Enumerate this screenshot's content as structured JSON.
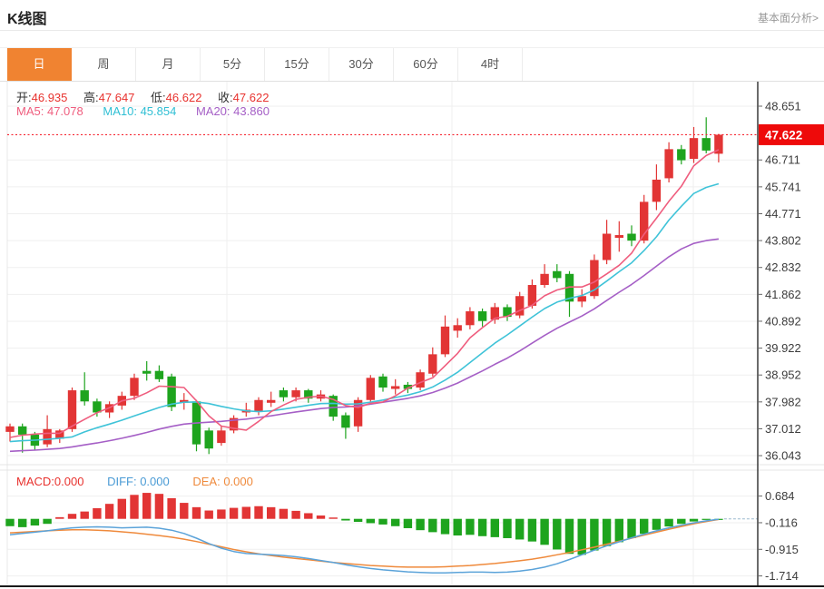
{
  "header": {
    "title": "K线图",
    "link": "基本面分析>"
  },
  "tabs": [
    {
      "label": "日",
      "active": true
    },
    {
      "label": "周"
    },
    {
      "label": "月"
    },
    {
      "label": "5分"
    },
    {
      "label": "15分"
    },
    {
      "label": "30分"
    },
    {
      "label": "60分"
    },
    {
      "label": "4时"
    }
  ],
  "ohlc": {
    "open_label": "开:",
    "open": "46.935",
    "high_label": "高:",
    "high": "47.647",
    "low_label": "低:",
    "low": "46.622",
    "close_label": "收:",
    "close": "47.622"
  },
  "ma_legend": {
    "ma5_label": "MA5:",
    "ma5": "47.078",
    "ma10_label": "MA10:",
    "ma10": "45.854",
    "ma20_label": "MA20:",
    "ma20": "43.860"
  },
  "macd_legend": {
    "macd_label": "MACD:",
    "macd": "0.000",
    "diff_label": "DIFF:",
    "diff": "0.000",
    "dea_label": "DEA:",
    "dea": "0.000"
  },
  "price_tag": {
    "value": "47.622"
  },
  "colors": {
    "up": "#e23535",
    "down": "#1ea41e",
    "ma5": "#ef5d7e",
    "ma10": "#3fc3d8",
    "ma20": "#a55fc6",
    "diff_line": "#5ba3d9",
    "dea_line": "#ef8a3c",
    "price_line": "#f5222d",
    "price_tag_bg": "#ee0a0a",
    "accent_tab": "#f08331",
    "axis": "#3a3a3a",
    "grid": "#efefef"
  },
  "chart_data": {
    "type": "candlestick+macd",
    "main": {
      "title": "K线图 (daily)",
      "price_line": 47.622,
      "y_ticks": [
        48.651,
        46.711,
        45.741,
        44.771,
        43.802,
        42.832,
        41.862,
        40.892,
        39.922,
        38.952,
        37.982,
        37.012,
        36.043
      ],
      "candles": [
        [
          36.9,
          37.2,
          36.55,
          37.1
        ],
        [
          37.1,
          37.2,
          36.15,
          36.8
        ],
        [
          36.8,
          36.9,
          36.25,
          36.4
        ],
        [
          36.45,
          37.5,
          36.35,
          37.0
        ],
        [
          36.65,
          37.0,
          36.5,
          36.95
        ],
        [
          37.0,
          38.5,
          36.9,
          38.4
        ],
        [
          38.4,
          39.05,
          37.85,
          38.0
        ],
        [
          38.0,
          38.1,
          37.45,
          37.6
        ],
        [
          37.6,
          38.0,
          37.4,
          37.9
        ],
        [
          37.85,
          38.35,
          37.7,
          38.2
        ],
        [
          38.2,
          39.0,
          38.05,
          38.85
        ],
        [
          39.1,
          39.45,
          38.75,
          39.0
        ],
        [
          39.1,
          39.3,
          38.7,
          38.8
        ],
        [
          38.9,
          39.0,
          37.65,
          37.8
        ],
        [
          37.95,
          38.3,
          37.7,
          38.05
        ],
        [
          38.0,
          38.05,
          36.2,
          36.45
        ],
        [
          36.95,
          37.05,
          36.1,
          36.3
        ],
        [
          36.5,
          37.1,
          36.4,
          36.95
        ],
        [
          36.95,
          37.5,
          36.85,
          37.4
        ],
        [
          37.6,
          37.95,
          37.45,
          37.7
        ],
        [
          37.65,
          38.15,
          37.5,
          38.05
        ],
        [
          37.95,
          38.35,
          37.8,
          38.05
        ],
        [
          38.4,
          38.5,
          38.0,
          38.15
        ],
        [
          38.15,
          38.5,
          38.0,
          38.4
        ],
        [
          38.4,
          38.45,
          37.95,
          38.1
        ],
        [
          38.1,
          38.4,
          38.0,
          38.25
        ],
        [
          38.2,
          38.25,
          37.3,
          37.45
        ],
        [
          37.5,
          37.6,
          36.65,
          37.05
        ],
        [
          37.1,
          38.15,
          36.9,
          38.05
        ],
        [
          38.05,
          38.95,
          37.9,
          38.85
        ],
        [
          38.9,
          39.0,
          38.35,
          38.5
        ],
        [
          38.45,
          38.8,
          38.25,
          38.55
        ],
        [
          38.6,
          38.7,
          38.3,
          38.45
        ],
        [
          38.5,
          39.15,
          38.4,
          39.05
        ],
        [
          39.0,
          39.95,
          38.9,
          39.7
        ],
        [
          39.7,
          41.1,
          39.6,
          40.7
        ],
        [
          40.55,
          41.0,
          40.3,
          40.75
        ],
        [
          40.75,
          41.4,
          40.6,
          41.25
        ],
        [
          41.25,
          41.35,
          40.7,
          40.9
        ],
        [
          40.95,
          41.55,
          40.8,
          41.4
        ],
        [
          41.4,
          41.5,
          40.9,
          41.05
        ],
        [
          41.1,
          41.95,
          41.0,
          41.8
        ],
        [
          41.45,
          42.4,
          41.35,
          42.2
        ],
        [
          42.2,
          42.95,
          42.1,
          42.6
        ],
        [
          42.7,
          42.95,
          42.3,
          42.45
        ],
        [
          42.6,
          42.7,
          41.05,
          41.6
        ],
        [
          41.6,
          42.05,
          41.4,
          41.8
        ],
        [
          41.8,
          43.3,
          41.7,
          43.1
        ],
        [
          43.1,
          44.55,
          42.95,
          44.05
        ],
        [
          43.9,
          44.5,
          43.4,
          44.0
        ],
        [
          44.05,
          44.35,
          43.6,
          43.8
        ],
        [
          43.8,
          45.45,
          43.7,
          45.2
        ],
        [
          45.2,
          46.55,
          44.9,
          46.0
        ],
        [
          46.05,
          47.35,
          45.9,
          47.1
        ],
        [
          47.1,
          47.25,
          46.55,
          46.7
        ],
        [
          46.75,
          47.9,
          46.6,
          47.5
        ],
        [
          47.5,
          48.25,
          46.95,
          47.05
        ],
        [
          46.935,
          47.647,
          46.622,
          47.622
        ]
      ],
      "ma5": [
        36.7,
        36.78,
        36.82,
        36.85,
        36.85,
        37.11,
        37.35,
        37.59,
        37.77,
        38.02,
        38.11,
        38.31,
        38.55,
        38.53,
        38.5,
        38.02,
        37.48,
        37.11,
        37.03,
        36.96,
        37.28,
        37.63,
        37.87,
        38.07,
        38.15,
        38.19,
        38.07,
        37.85,
        37.78,
        37.93,
        37.98,
        38.2,
        38.48,
        38.68,
        38.85,
        39.29,
        39.73,
        40.29,
        40.66,
        41.0,
        41.07,
        41.28,
        41.47,
        41.81,
        42.02,
        42.13,
        42.13,
        42.31,
        42.6,
        42.91,
        43.35,
        44.03,
        44.61,
        45.22,
        45.76,
        46.5,
        46.87,
        47.08
      ],
      "ma10": [
        36.55,
        36.58,
        36.6,
        36.63,
        36.67,
        36.72,
        36.9,
        37.05,
        37.18,
        37.32,
        37.48,
        37.63,
        37.78,
        37.9,
        37.97,
        37.98,
        37.92,
        37.82,
        37.73,
        37.66,
        37.63,
        37.66,
        37.72,
        37.79,
        37.86,
        37.92,
        37.93,
        37.9,
        37.91,
        37.97,
        38.05,
        38.14,
        38.23,
        38.35,
        38.52,
        38.77,
        39.05,
        39.4,
        39.75,
        40.1,
        40.4,
        40.72,
        41.04,
        41.35,
        41.58,
        41.72,
        41.82,
        42.02,
        42.34,
        42.68,
        43.0,
        43.44,
        43.94,
        44.54,
        45.04,
        45.5,
        45.72,
        45.85
      ],
      "ma20": [
        36.2,
        36.22,
        36.24,
        36.27,
        36.3,
        36.36,
        36.43,
        36.5,
        36.58,
        36.67,
        36.77,
        36.88,
        37.0,
        37.1,
        37.18,
        37.22,
        37.25,
        37.28,
        37.32,
        37.36,
        37.42,
        37.48,
        37.55,
        37.62,
        37.68,
        37.74,
        37.78,
        37.8,
        37.84,
        37.9,
        37.97,
        38.04,
        38.11,
        38.2,
        38.32,
        38.48,
        38.66,
        38.88,
        39.1,
        39.34,
        39.56,
        39.82,
        40.1,
        40.38,
        40.64,
        40.86,
        41.08,
        41.34,
        41.64,
        41.94,
        42.22,
        42.54,
        42.88,
        43.22,
        43.5,
        43.7,
        43.8,
        43.86
      ]
    },
    "macd": {
      "y_ticks": [
        0.684,
        -0.116,
        -0.915,
        -1.714
      ],
      "hist": [
        -0.22,
        -0.25,
        -0.2,
        -0.15,
        0.05,
        0.15,
        0.22,
        0.32,
        0.45,
        0.6,
        0.72,
        0.78,
        0.75,
        0.62,
        0.48,
        0.35,
        0.25,
        0.28,
        0.33,
        0.36,
        0.38,
        0.35,
        0.3,
        0.24,
        0.17,
        0.1,
        0.04,
        -0.05,
        -0.09,
        -0.13,
        -0.17,
        -0.22,
        -0.28,
        -0.34,
        -0.4,
        -0.46,
        -0.5,
        -0.48,
        -0.52,
        -0.55,
        -0.58,
        -0.62,
        -0.68,
        -0.78,
        -0.92,
        -1.05,
        -1.08,
        -0.95,
        -0.82,
        -0.7,
        -0.58,
        -0.45,
        -0.33,
        -0.23,
        -0.15,
        -0.08,
        -0.03,
        -0.01
      ],
      "diff": [
        -0.48,
        -0.44,
        -0.4,
        -0.36,
        -0.31,
        -0.27,
        -0.25,
        -0.24,
        -0.25,
        -0.27,
        -0.26,
        -0.25,
        -0.28,
        -0.34,
        -0.44,
        -0.58,
        -0.74,
        -0.88,
        -0.98,
        -1.04,
        -1.06,
        -1.08,
        -1.1,
        -1.14,
        -1.19,
        -1.25,
        -1.31,
        -1.38,
        -1.44,
        -1.49,
        -1.53,
        -1.56,
        -1.59,
        -1.61,
        -1.62,
        -1.62,
        -1.61,
        -1.6,
        -1.6,
        -1.61,
        -1.6,
        -1.57,
        -1.52,
        -1.45,
        -1.35,
        -1.22,
        -1.08,
        -0.94,
        -0.81,
        -0.69,
        -0.57,
        -0.46,
        -0.36,
        -0.27,
        -0.19,
        -0.12,
        -0.06,
        -0.01
      ],
      "dea": [
        -0.42,
        -0.4,
        -0.38,
        -0.36,
        -0.34,
        -0.33,
        -0.33,
        -0.34,
        -0.36,
        -0.39,
        -0.42,
        -0.46,
        -0.5,
        -0.55,
        -0.61,
        -0.68,
        -0.76,
        -0.84,
        -0.92,
        -0.99,
        -1.05,
        -1.1,
        -1.15,
        -1.19,
        -1.23,
        -1.27,
        -1.31,
        -1.34,
        -1.37,
        -1.4,
        -1.42,
        -1.44,
        -1.45,
        -1.45,
        -1.45,
        -1.44,
        -1.42,
        -1.4,
        -1.37,
        -1.34,
        -1.3,
        -1.26,
        -1.21,
        -1.15,
        -1.08,
        -1.01,
        -0.93,
        -0.85,
        -0.76,
        -0.67,
        -0.58,
        -0.49,
        -0.4,
        -0.31,
        -0.23,
        -0.15,
        -0.08,
        -0.02
      ]
    }
  }
}
